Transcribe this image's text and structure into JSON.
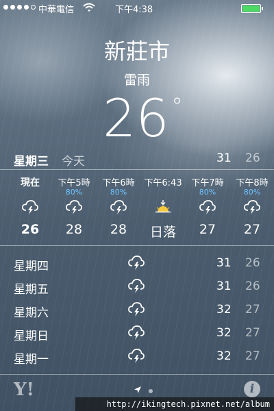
{
  "status_bar": {
    "carrier": "中華電信",
    "time": "下午4:38"
  },
  "header": {
    "city": "新莊市",
    "condition": "雷雨",
    "temperature": "26",
    "degree_symbol": "°"
  },
  "today": {
    "day": "星期三",
    "label": "今天",
    "high": "31",
    "low": "26"
  },
  "hourly": [
    {
      "time": "現在",
      "precip": "",
      "icon": "thunderstorm-icon",
      "value": "26"
    },
    {
      "time": "下午5時",
      "precip": "80%",
      "icon": "thunderstorm-icon",
      "value": "28"
    },
    {
      "time": "下午6時",
      "precip": "80%",
      "icon": "thunderstorm-icon",
      "value": "28"
    },
    {
      "time": "下午6:43",
      "precip": "",
      "icon": "sunset-icon",
      "value": "日落"
    },
    {
      "time": "下午7時",
      "precip": "80%",
      "icon": "thunderstorm-icon",
      "value": "27"
    },
    {
      "time": "下午8時",
      "precip": "80%",
      "icon": "thunderstorm-icon",
      "value": "27"
    }
  ],
  "daily": [
    {
      "day": "星期四",
      "icon": "thunderstorm-icon",
      "high": "31",
      "low": "26"
    },
    {
      "day": "星期五",
      "icon": "thunderstorm-icon",
      "high": "31",
      "low": "26"
    },
    {
      "day": "星期六",
      "icon": "thunderstorm-icon",
      "high": "32",
      "low": "27"
    },
    {
      "day": "星期日",
      "icon": "thunderstorm-icon",
      "high": "32",
      "low": "27"
    },
    {
      "day": "星期一",
      "icon": "thunderstorm-icon",
      "high": "32",
      "low": "27"
    }
  ],
  "footer": {
    "yahoo": "Y!",
    "info": "i"
  },
  "watermark": "http://ikingtech.pixnet.net/album",
  "colors": {
    "precip": "#6fc4ff",
    "battery": "#4cd964"
  }
}
